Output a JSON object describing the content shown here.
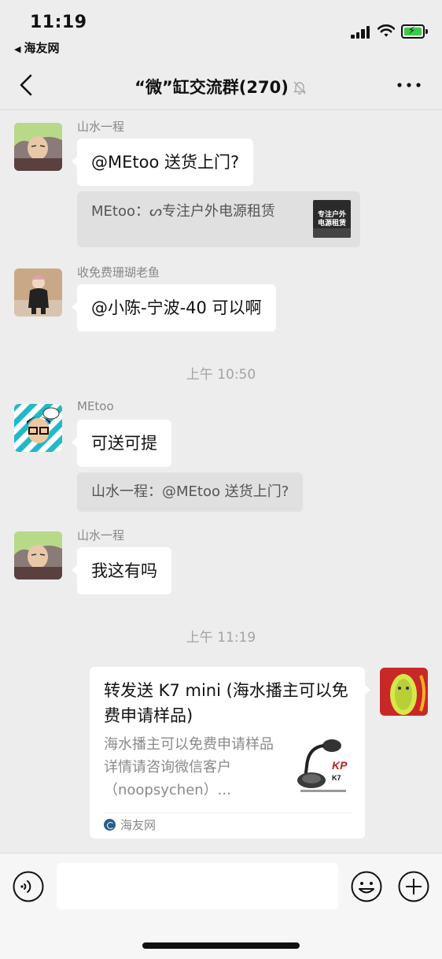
{
  "status_bar": {
    "time": "11:19",
    "back_app": "海友网",
    "back_arrow": "◀",
    "battery_color": "#3ec94a"
  },
  "nav": {
    "title": "“微”缸交流群(270)",
    "back_icon": "chevron-left-icon",
    "mute_icon": "bell-slash-icon",
    "more_icon": "more-dots-icon"
  },
  "messages": [
    {
      "sender": "山水一程",
      "text": "@MEtoo 送货上门?",
      "quote": "MEtoo：ᔕ专注户外电源租赁",
      "quote_thumb_lines": [
        "专注户外",
        "电源租赁"
      ]
    },
    {
      "sender": "收免费珊瑚老鱼",
      "text": "@小陈-宁波-40 可以啊"
    },
    {
      "timestamp": "上午 10:50"
    },
    {
      "sender": "MEtoo",
      "text": "可送可提",
      "quote": "山水一程：@MEtoo 送货上门?"
    },
    {
      "sender": "山水一程",
      "text": "我这有吗"
    },
    {
      "timestamp": "上午 11:19"
    }
  ],
  "share_card": {
    "title": "转发送 K7 mini (海水播主可以免费申请样品)",
    "description": "海水播主可以免费申请样品详情请咨询微信客户（noopsychen）...",
    "thumb_brand": "K7",
    "source": "海友网"
  },
  "input_bar": {
    "placeholder": "",
    "voice_icon": "voice-icon",
    "emoji_icon": "emoji-icon",
    "plus_icon": "plus-icon"
  }
}
